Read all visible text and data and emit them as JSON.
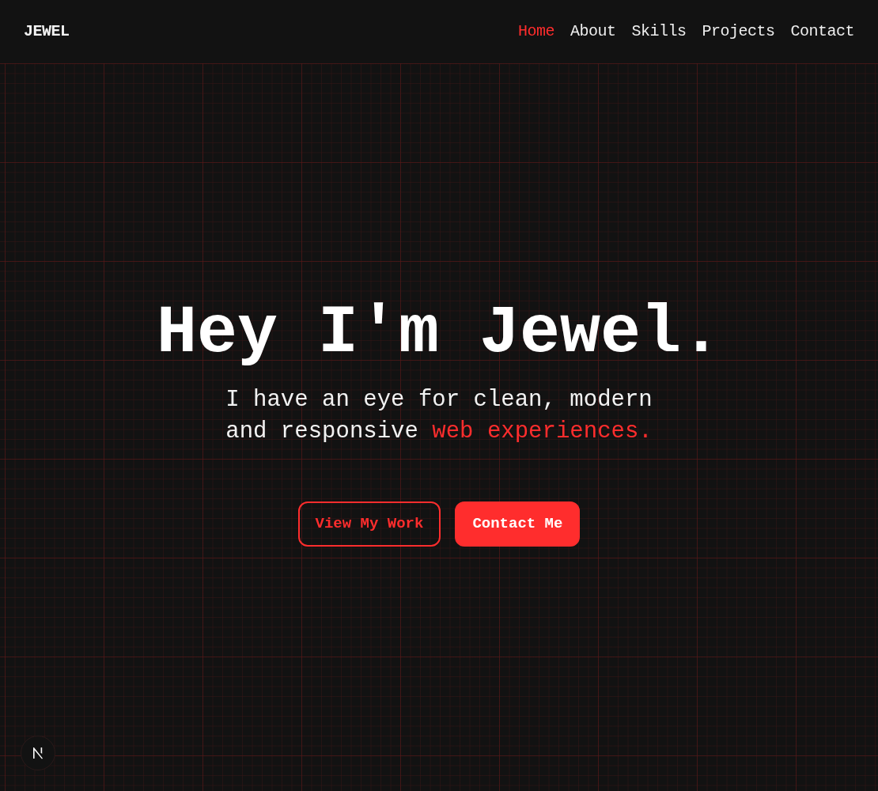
{
  "brand": "JEWEL",
  "nav": [
    {
      "label": "Home",
      "selected": true
    },
    {
      "label": "About",
      "selected": false
    },
    {
      "label": "Skills",
      "selected": false
    },
    {
      "label": "Projects",
      "selected": false
    },
    {
      "label": "Contact",
      "selected": false
    }
  ],
  "hero": {
    "title": "Hey I'm Jewel.",
    "subtitle_lines": [
      [
        {
          "text": "I have an eye for clean, modern",
          "accent": false
        }
      ],
      [
        {
          "text": "and responsive ",
          "accent": false
        },
        {
          "text": "web experiences.",
          "accent": true
        }
      ]
    ],
    "buttons": [
      {
        "label": "View My Work",
        "kind": "outline"
      },
      {
        "label": "Contact Me",
        "kind": "solid"
      }
    ]
  }
}
